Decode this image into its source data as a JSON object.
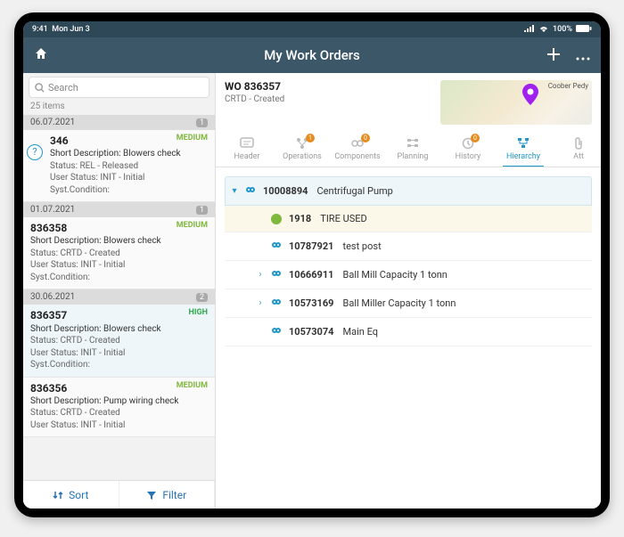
{
  "status": {
    "time": "9:41",
    "date": "Mon Jun 3",
    "battery": "100%"
  },
  "nav": {
    "title": "My Work Orders"
  },
  "sidebar": {
    "search_placeholder": "Search",
    "count": "25 items",
    "groups": [
      {
        "date": "06.07.2021",
        "badge": "1",
        "items": [
          {
            "prio": "MEDIUM",
            "prio_cls": "medium",
            "num": "346",
            "desc": "Short Description: Blowers check",
            "l1": "Status: REL - Released",
            "l2": "User Status: INIT - Initial",
            "l3": "Syst.Condition:",
            "help": true
          }
        ]
      },
      {
        "date": "01.07.2021",
        "badge": "1",
        "items": [
          {
            "prio": "MEDIUM",
            "prio_cls": "medium",
            "num": "836358",
            "desc": "Short Description: Blowers check",
            "l1": "Status: CRTD - Created",
            "l2": "User Status: INIT - Initial",
            "l3": "Syst.Condition:"
          }
        ]
      },
      {
        "date": "30.06.2021",
        "badge": "2",
        "items": [
          {
            "prio": "HIGH",
            "prio_cls": "high",
            "num": "836357",
            "desc": "Short Description: Blowers check",
            "l1": "Status: CRTD - Created",
            "l2": "User Status: INIT - Initial",
            "l3": "Syst.Condition:",
            "selected": true
          },
          {
            "prio": "MEDIUM",
            "prio_cls": "medium",
            "num": "836356",
            "desc": "Short Description: Pump wiring check",
            "l1": "Status: CRTD - Created",
            "l2": "User Status: INIT - Initial",
            "l3": ""
          }
        ]
      }
    ],
    "sort": "Sort",
    "filter": "Filter"
  },
  "main": {
    "wo": "WO 836357",
    "status": "CRTD - Created",
    "map_label": "Coober Pedy",
    "tabs": [
      {
        "id": "header",
        "label": "Header"
      },
      {
        "id": "operations",
        "label": "Operations",
        "badge": "1"
      },
      {
        "id": "components",
        "label": "Components",
        "badge": "0"
      },
      {
        "id": "planning",
        "label": "Planning"
      },
      {
        "id": "history",
        "label": "History",
        "badge": "0"
      },
      {
        "id": "hierarchy",
        "label": "Hierarchy",
        "active": true
      },
      {
        "id": "att",
        "label": "Att"
      }
    ],
    "tree": [
      {
        "cls": "root",
        "indent": 0,
        "exp": "▾",
        "icon": "gear",
        "code": "10008894",
        "name": "Centrifugal Pump"
      },
      {
        "cls": "tire",
        "indent": 1,
        "icon": "circle",
        "code": "1918",
        "name": "TIRE USED"
      },
      {
        "indent": 1,
        "icon": "gear",
        "code": "10787921",
        "name": "test post"
      },
      {
        "indent": 1,
        "exp": "›",
        "icon": "gear",
        "code": "10666911",
        "name": "Ball Mill Capacity 1 tonn"
      },
      {
        "indent": 1,
        "exp": "›",
        "icon": "gear",
        "code": "10573169",
        "name": "Ball Miller Capacity 1 tonn"
      },
      {
        "indent": 1,
        "icon": "gear",
        "code": "10573074",
        "name": "Main Eq"
      }
    ]
  },
  "colors": {
    "accent": "#2396c9",
    "badge": "#e78b1e"
  }
}
